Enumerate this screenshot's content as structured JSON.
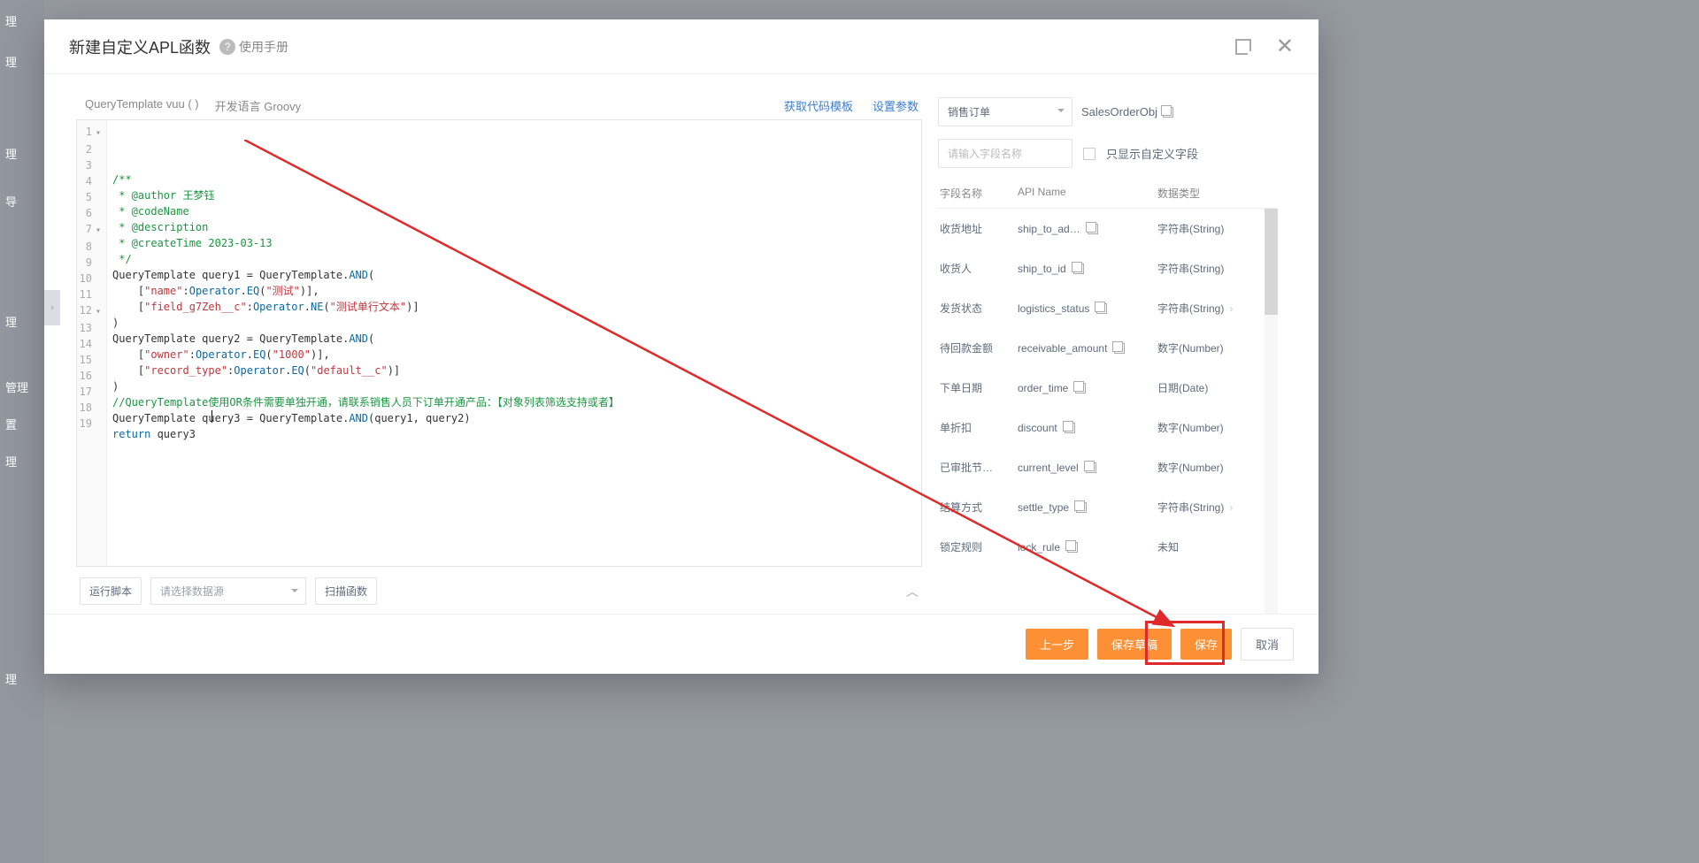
{
  "bg_menu": [
    "理",
    "理",
    "理",
    "导",
    "理",
    "管理",
    "置",
    "理",
    "理"
  ],
  "modal": {
    "title": "新建自定义APL函数",
    "help": "使用手册"
  },
  "code_head": {
    "left1": "QueryTemplate vuu ( )",
    "left2": "开发语言 Groovy",
    "link1": "获取代码模板",
    "link2": "设置参数"
  },
  "code_lines": [
    {
      "n": "1",
      "fold": "▾",
      "seg": [
        {
          "c": "cmt",
          "t": "/**"
        }
      ]
    },
    {
      "n": "2",
      "seg": [
        {
          "c": "cmt",
          "t": " * @author 王梦钰"
        }
      ]
    },
    {
      "n": "3",
      "seg": [
        {
          "c": "cmt",
          "t": " * @codeName"
        }
      ]
    },
    {
      "n": "4",
      "seg": [
        {
          "c": "cmt",
          "t": " * @description"
        }
      ]
    },
    {
      "n": "5",
      "seg": [
        {
          "c": "cmt",
          "t": " * @createTime 2023-03-13"
        }
      ]
    },
    {
      "n": "6",
      "seg": [
        {
          "c": "cmt",
          "t": " */"
        }
      ]
    },
    {
      "n": "7",
      "fold": "▾",
      "seg": [
        {
          "c": "id",
          "t": "QueryTemplate query1 = QueryTemplate."
        },
        {
          "c": "kw",
          "t": "AND"
        },
        {
          "c": "id",
          "t": "("
        }
      ]
    },
    {
      "n": "8",
      "seg": [
        {
          "c": "id",
          "t": "    ["
        },
        {
          "c": "str",
          "t": "\"name\""
        },
        {
          "c": "id",
          "t": ":"
        },
        {
          "c": "kw",
          "t": "Operator"
        },
        {
          "c": "id",
          "t": "."
        },
        {
          "c": "kw",
          "t": "EQ"
        },
        {
          "c": "id",
          "t": "("
        },
        {
          "c": "str",
          "t": "\"测试\""
        },
        {
          "c": "id",
          "t": ")],"
        }
      ]
    },
    {
      "n": "9",
      "seg": [
        {
          "c": "id",
          "t": "    ["
        },
        {
          "c": "str",
          "t": "\"field_g7Zeh__c\""
        },
        {
          "c": "id",
          "t": ":"
        },
        {
          "c": "kw",
          "t": "Operator"
        },
        {
          "c": "id",
          "t": "."
        },
        {
          "c": "kw",
          "t": "NE"
        },
        {
          "c": "id",
          "t": "("
        },
        {
          "c": "str",
          "t": "\"测试单行文本\""
        },
        {
          "c": "id",
          "t": ")]"
        }
      ]
    },
    {
      "n": "10",
      "seg": [
        {
          "c": "id",
          "t": ")"
        }
      ]
    },
    {
      "n": "11",
      "seg": [
        {
          "c": "id",
          "t": ""
        }
      ]
    },
    {
      "n": "12",
      "fold": "▾",
      "seg": [
        {
          "c": "id",
          "t": "QueryTemplate query2 = QueryTemplate."
        },
        {
          "c": "kw",
          "t": "AND"
        },
        {
          "c": "id",
          "t": "("
        }
      ]
    },
    {
      "n": "13",
      "seg": [
        {
          "c": "id",
          "t": "    ["
        },
        {
          "c": "str",
          "t": "\"owner\""
        },
        {
          "c": "id",
          "t": ":"
        },
        {
          "c": "kw",
          "t": "Operator"
        },
        {
          "c": "id",
          "t": "."
        },
        {
          "c": "kw",
          "t": "EQ"
        },
        {
          "c": "id",
          "t": "("
        },
        {
          "c": "str",
          "t": "\"1000\""
        },
        {
          "c": "id",
          "t": ")],"
        }
      ]
    },
    {
      "n": "14",
      "seg": [
        {
          "c": "id",
          "t": "    ["
        },
        {
          "c": "str",
          "t": "\"record_type\""
        },
        {
          "c": "id",
          "t": ":"
        },
        {
          "c": "kw",
          "t": "Operator"
        },
        {
          "c": "id",
          "t": "."
        },
        {
          "c": "kw",
          "t": "EQ"
        },
        {
          "c": "id",
          "t": "("
        },
        {
          "c": "str",
          "t": "\"default__c\""
        },
        {
          "c": "id",
          "t": ")]"
        }
      ]
    },
    {
      "n": "15",
      "seg": [
        {
          "c": "id",
          "t": ")"
        }
      ]
    },
    {
      "n": "16",
      "seg": [
        {
          "c": "id",
          "t": ""
        }
      ]
    },
    {
      "n": "17",
      "seg": [
        {
          "c": "cmt",
          "t": "//QueryTemplate使用OR条件需要单独开通，请联系销售人员下订单开通产品：【对象列表筛选支持或者】"
        }
      ]
    },
    {
      "n": "18",
      "seg": [
        {
          "c": "id",
          "t": "QueryTemplate query3 = QueryTemplate."
        },
        {
          "c": "kw",
          "t": "AND"
        },
        {
          "c": "id",
          "t": "(query1, query2)"
        }
      ]
    },
    {
      "n": "19",
      "seg": [
        {
          "c": "kw",
          "t": "return"
        },
        {
          "c": "id",
          "t": " query3"
        }
      ]
    }
  ],
  "code_foot": {
    "run": "运行脚本",
    "select_placeholder": "请选择数据源",
    "scan": "扫描函数"
  },
  "side": {
    "obj_select": "销售订单",
    "obj_api": "SalesOrderObj",
    "field_placeholder": "请输入字段名称",
    "custom_only": "只显示自定义字段",
    "th1": "字段名称",
    "th2": "API Name",
    "th3": "数据类型",
    "rows": [
      {
        "name": "锁定规则",
        "api": "lock_rule",
        "type": "未知",
        "exp": false
      },
      {
        "name": "结算方式",
        "api": "settle_type",
        "type": "字符串(String)",
        "exp": true
      },
      {
        "name": "已审批节…",
        "api": "current_level",
        "type": "数字(Number)",
        "exp": false
      },
      {
        "name": "单折扣",
        "api": "discount",
        "type": "数字(Number)",
        "exp": false
      },
      {
        "name": "下单日期",
        "api": "order_time",
        "type": "日期(Date)",
        "exp": false
      },
      {
        "name": "待回款金额",
        "api": "receivable_amount",
        "type": "数字(Number)",
        "exp": false
      },
      {
        "name": "发货状态",
        "api": "logistics_status",
        "type": "字符串(String)",
        "exp": true
      },
      {
        "name": "收货人",
        "api": "ship_to_id",
        "type": "字符串(String)",
        "exp": false
      },
      {
        "name": "收货地址",
        "api": "ship_to_ad…",
        "type": "字符串(String)",
        "exp": false
      }
    ]
  },
  "footer": {
    "prev": "上一步",
    "draft": "保存草稿",
    "save": "保存",
    "cancel": "取消"
  }
}
